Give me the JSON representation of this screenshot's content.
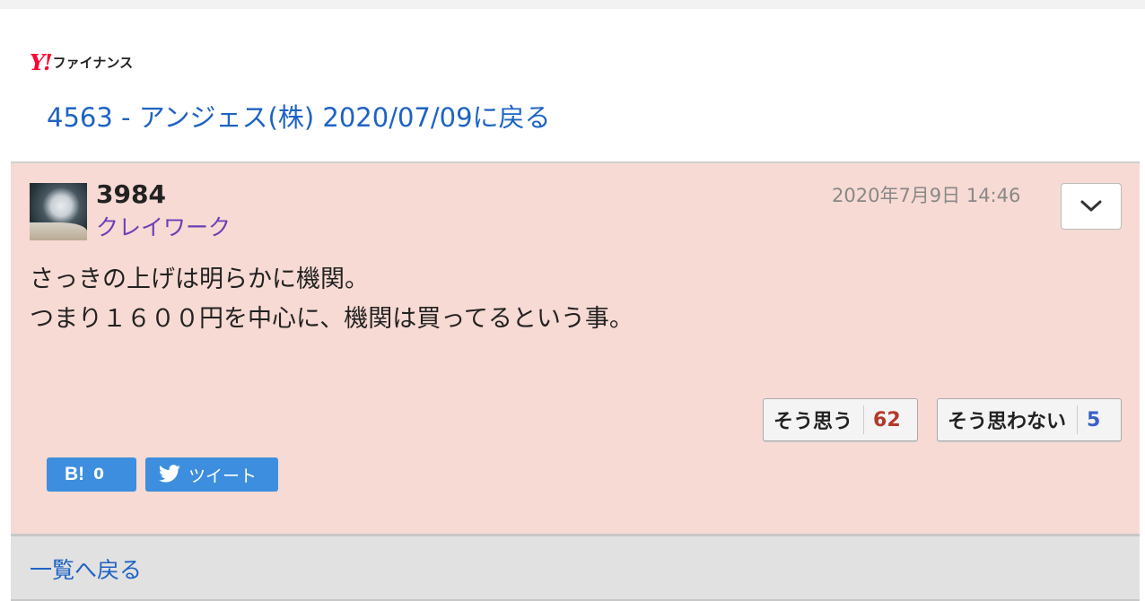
{
  "header": {
    "logo_y": "Y!",
    "logo_text": "ファイナンス",
    "back_link": "4563 - アンジェス(株) 2020/07/09に戻る"
  },
  "post": {
    "username": "3984",
    "nickname": "クレイワーク",
    "timestamp": "2020年7月9日 14:46",
    "lines": [
      "さっきの上げは明らかに機関。",
      "つまり１６００円を中心に、機関は買ってるという事。"
    ],
    "vote_agree_label": "そう思う",
    "vote_agree_count": "62",
    "vote_disagree_label": "そう思わない",
    "vote_disagree_count": "5",
    "hatena_label": "B!",
    "hatena_count": "0",
    "tweet_label": "ツイート"
  },
  "footer": {
    "back_to_list": "一覧へ戻る"
  },
  "colors": {
    "post_bg": "#f7dad3",
    "link": "#1e63c3",
    "nickname": "#6a3fb6",
    "agree_count": "#b23a2a",
    "disagree_count": "#3a5fc8",
    "share_blue": "#3d8ede"
  },
  "icons": {
    "menu": "chevron-down-icon",
    "tweet": "twitter-bird-icon"
  }
}
